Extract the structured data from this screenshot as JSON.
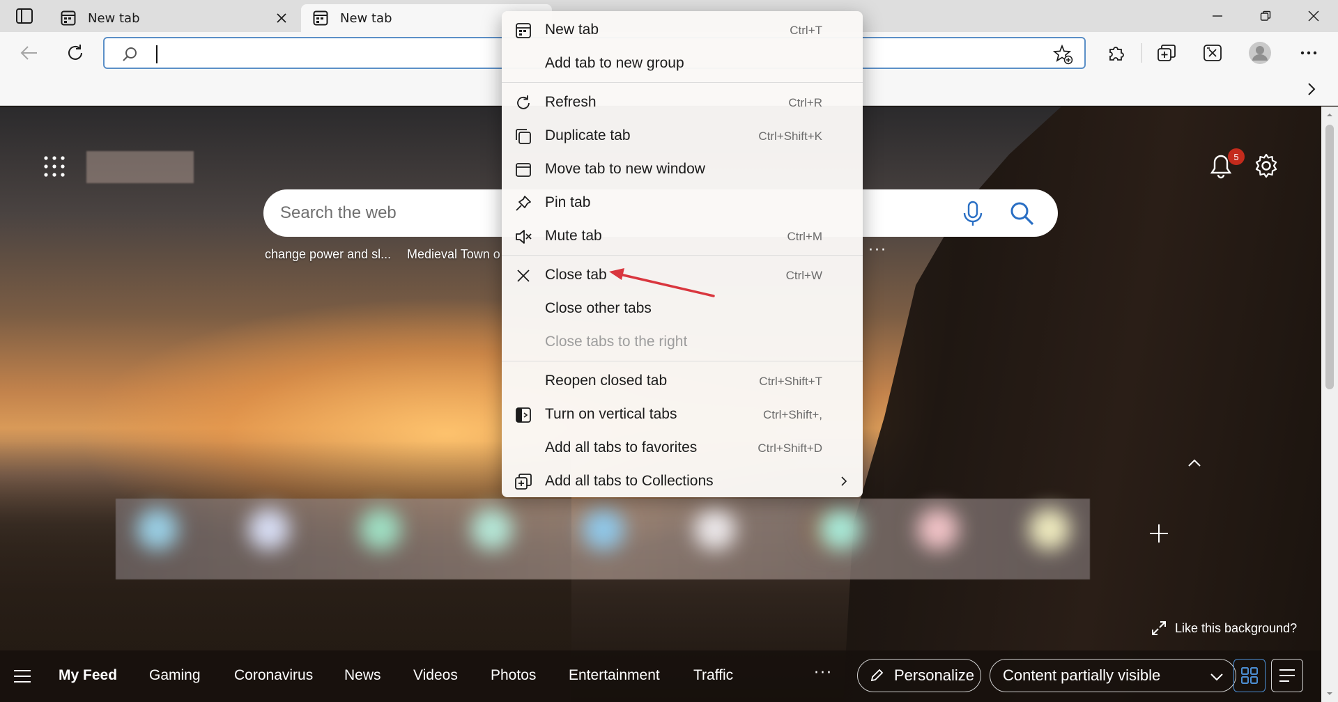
{
  "tabs": [
    {
      "title": "New tab",
      "active": false
    },
    {
      "title": "New tab",
      "active": true
    }
  ],
  "address_bar": {
    "value": "",
    "placeholder": ""
  },
  "newtab": {
    "search_placeholder": "Search the web",
    "trending": [
      "change power and sl...",
      "Medieval Town o"
    ],
    "notifications_count": "5",
    "like_background": "Like this background?"
  },
  "feed": {
    "items": [
      "My Feed",
      "Gaming",
      "Coronavirus",
      "News",
      "Videos",
      "Photos",
      "Entertainment",
      "Traffic"
    ],
    "personalize": "Personalize",
    "content_visibility": "Content partially visible"
  },
  "context_menu": {
    "items": [
      {
        "label": "New tab",
        "shortcut": "Ctrl+T",
        "icon": "new-tab-icon"
      },
      {
        "label": "Add tab to new group",
        "shortcut": "",
        "icon": ""
      },
      {
        "label": "Refresh",
        "shortcut": "Ctrl+R",
        "icon": "refresh-icon"
      },
      {
        "label": "Duplicate tab",
        "shortcut": "Ctrl+Shift+K",
        "icon": "duplicate-icon"
      },
      {
        "label": "Move tab to new window",
        "shortcut": "",
        "icon": "window-icon"
      },
      {
        "label": "Pin tab",
        "shortcut": "",
        "icon": "pin-icon"
      },
      {
        "label": "Mute tab",
        "shortcut": "Ctrl+M",
        "icon": "mute-icon"
      },
      {
        "label": "Close tab",
        "shortcut": "Ctrl+W",
        "icon": "close-icon"
      },
      {
        "label": "Close other tabs",
        "shortcut": "",
        "icon": ""
      },
      {
        "label": "Close tabs to the right",
        "shortcut": "",
        "icon": "",
        "disabled": true
      },
      {
        "label": "Reopen closed tab",
        "shortcut": "Ctrl+Shift+T",
        "icon": ""
      },
      {
        "label": "Turn on vertical tabs",
        "shortcut": "Ctrl+Shift+,",
        "icon": "vertical-tabs-icon"
      },
      {
        "label": "Add all tabs to favorites",
        "shortcut": "Ctrl+Shift+D",
        "icon": ""
      },
      {
        "label": "Add all tabs to Collections",
        "shortcut": "",
        "icon": "collections-icon",
        "submenu": true
      }
    ]
  },
  "colors": {
    "accent": "#4c8fd4",
    "badge": "#c42b1c",
    "annotation_arrow": "#d9363e"
  }
}
